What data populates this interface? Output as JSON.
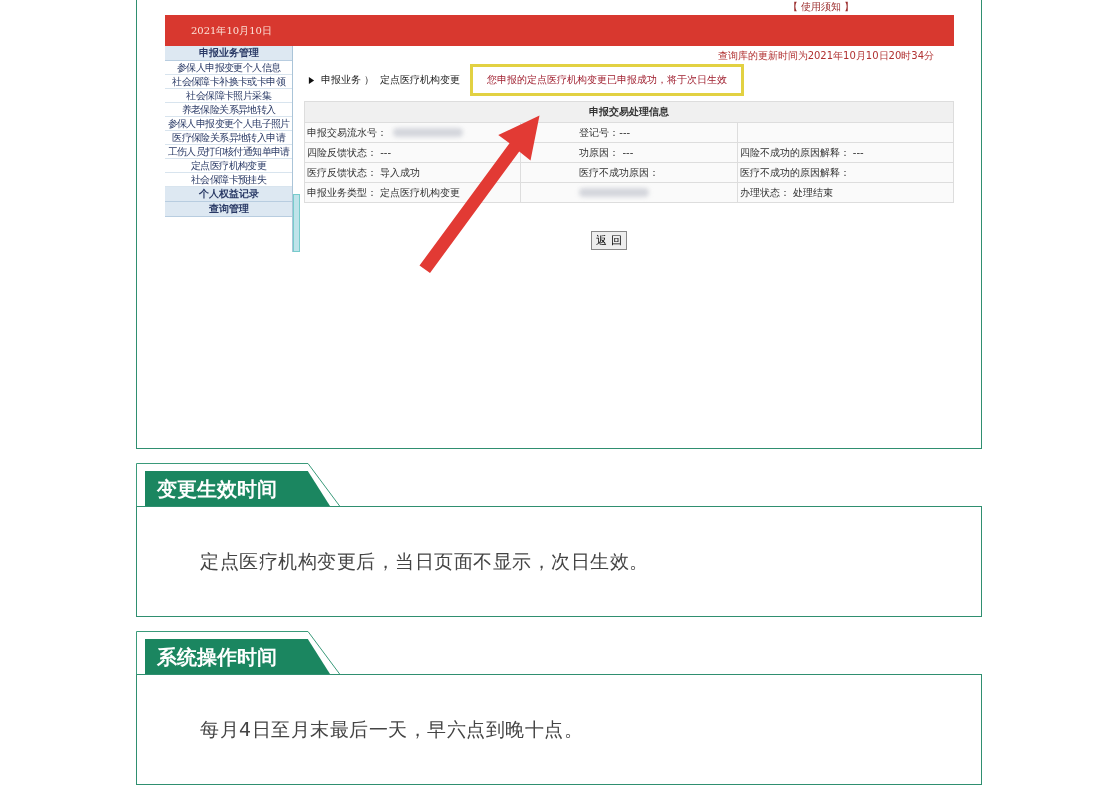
{
  "screenshot": {
    "notice_link": "【 使用须知 】",
    "date": "2021年10月10日",
    "sidebar": [
      {
        "kind": "header",
        "label": "申报业务管理"
      },
      {
        "kind": "item",
        "label": "参保人申报变更个人信息"
      },
      {
        "kind": "item",
        "label": "社会保障卡补换卡或卡申领"
      },
      {
        "kind": "item",
        "label": "社会保障卡照片采集"
      },
      {
        "kind": "item",
        "label": "养老保险关系异地转入"
      },
      {
        "kind": "item",
        "label": "参保人申报变更个人电子照片"
      },
      {
        "kind": "item",
        "label": "医疗保险关系异地转入申请"
      },
      {
        "kind": "item",
        "label": "工伤人员打印核付通知单申请"
      },
      {
        "kind": "item",
        "label": "定点医疗机构变更"
      },
      {
        "kind": "item",
        "label": "社会保障卡预挂失"
      },
      {
        "kind": "header",
        "label": "个人权益记录"
      },
      {
        "kind": "header",
        "label": "查询管理"
      }
    ],
    "update_time": "查询库的更新时间为2021年10月10日20时34分",
    "breadcrumb": [
      "申报业务 ）",
      "定点医疗机构变更"
    ],
    "success_message": "您申报的定点医疗机构变更已申报成功，将于次日生效",
    "table": {
      "title": "申报交易处理信息",
      "rows": [
        [
          {
            "text": "申报交易流水号：",
            "blurred": true
          },
          {
            "text": "登记号：---",
            "blurred": false
          },
          {
            "blurred": false
          }
        ],
        [
          {
            "text": "四险反馈状态：  ---",
            "blurred": false
          },
          {
            "text": "功原因：  ---",
            "blurred": false
          },
          {
            "text": "四险不成功的原因解释：  ---",
            "blurred": false
          }
        ],
        [
          {
            "text": "医疗反馈状态：  导入成功",
            "blurred": false
          },
          {
            "text": "医疗不成功原因：",
            "blurred": false
          },
          {
            "text": "医疗不成功的原因解释：",
            "blurred": false
          }
        ],
        [
          {
            "text": "申报业务类型：  定点医疗机构变更",
            "blurred": false
          },
          {
            "blurred": true
          },
          {
            "text": "办理状态：  处理结束",
            "blurred": false
          }
        ]
      ]
    },
    "back_button": "返 回"
  },
  "sections": [
    {
      "title": "变更生效时间",
      "body": "定点医疗机构变更后，当日页面不显示，次日生效。"
    },
    {
      "title": "系统操作时间",
      "body": "每月4日至月末最后一天，早六点到晚十点。"
    }
  ]
}
